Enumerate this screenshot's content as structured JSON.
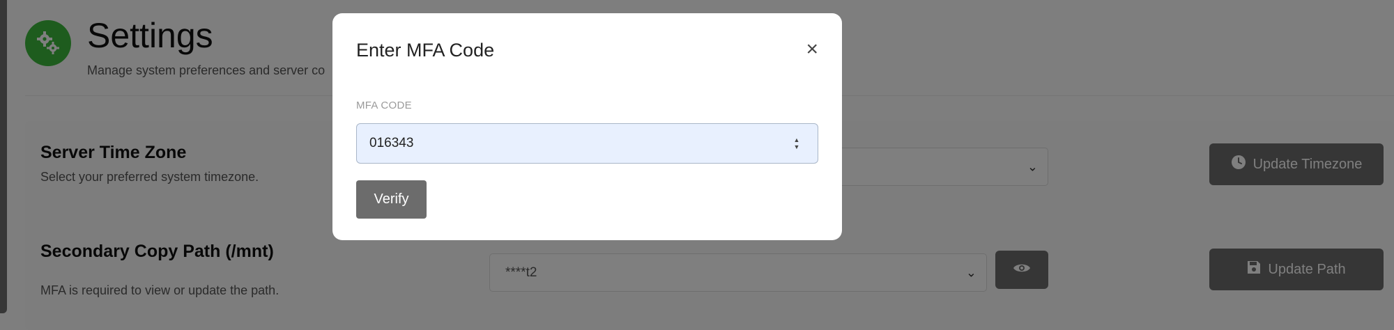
{
  "header": {
    "title": "Settings",
    "subtitle": "Manage system preferences and server co"
  },
  "timezone_section": {
    "title": "Server Time Zone",
    "description": "Select your preferred system timezone.",
    "select_value": "",
    "update_button_label": "Update Timezone"
  },
  "path_section": {
    "title": "Secondary Copy Path (/mnt)",
    "description": "MFA is required to view or update the path.",
    "select_value": "****t2",
    "update_button_label": "Update Path"
  },
  "modal": {
    "title": "Enter MFA Code",
    "close_label": "×",
    "field_label": "MFA CODE",
    "code_value": "016343",
    "verify_label": "Verify"
  },
  "colors": {
    "header_icon_bg": "#3cb83c",
    "button_bg": "#6c6c6c",
    "input_bg": "#e8f0fe",
    "overlay": "rgba(0,0,0,0.5)"
  },
  "icons": [
    "gears-icon",
    "clock-icon",
    "eye-icon",
    "save-icon",
    "chevron-down-icon",
    "close-icon"
  ]
}
